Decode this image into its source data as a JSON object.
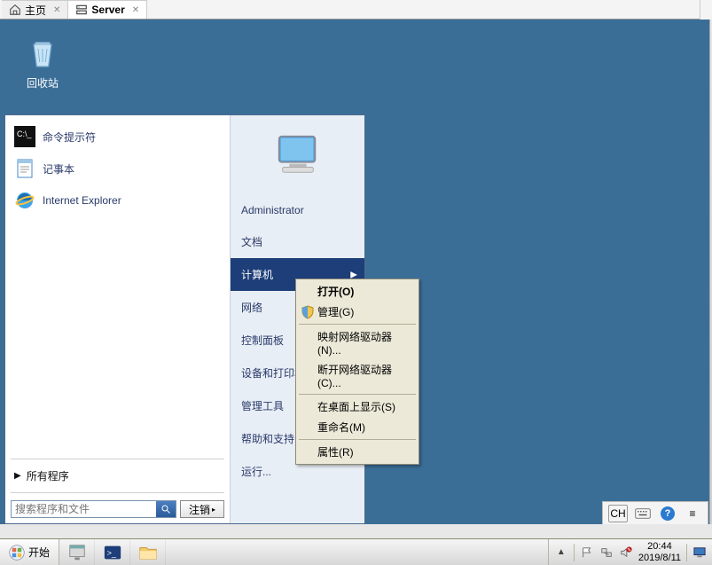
{
  "tabs": {
    "home": "主页",
    "server": "Server"
  },
  "desktop": {
    "recycle_bin": "回收站"
  },
  "start_menu": {
    "programs": {
      "cmd": "命令提示符",
      "notepad": "记事本",
      "ie": "Internet Explorer"
    },
    "all_programs": "所有程序",
    "search_placeholder": "搜索程序和文件",
    "logoff": "注销",
    "right": {
      "username": "Administrator",
      "documents": "文档",
      "computer": "计算机",
      "network": "网络",
      "control_panel": "控制面板",
      "devices_printers": "设备和打印机",
      "admin_tools": "管理工具",
      "help_support": "帮助和支持",
      "run": "运行..."
    }
  },
  "context_menu": {
    "open": "打开(O)",
    "manage": "管理(G)",
    "map_drive": "映射网络驱动器(N)...",
    "disconnect_drive": "断开网络驱动器(C)...",
    "show_on_desktop": "在桌面上显示(S)",
    "rename": "重命名(M)",
    "properties": "属性(R)"
  },
  "aux_bar": {
    "ch": "CH"
  },
  "tray": {
    "time": "20:44",
    "date": "2019/8/11"
  },
  "taskbar": {
    "start": "开始"
  },
  "icons": {
    "home": "home-icon",
    "server": "server-icon",
    "close": "close-icon",
    "recycle": "recycle-bin-icon",
    "cmd": "cmd-icon",
    "notepad": "notepad-icon",
    "ie": "ie-icon",
    "avatar": "monitor-avatar-icon",
    "shield": "shield-icon",
    "search": "search-icon",
    "start": "windows-logo-icon",
    "srvmgr": "server-manager-icon",
    "powershell": "powershell-icon",
    "explorer": "explorer-icon",
    "up": "chevron-up-icon",
    "net": "network-tray-icon",
    "vol": "volume-tray-icon",
    "mon": "monitor-tray-icon",
    "keyboard": "keyboard-icon",
    "help": "help-icon"
  }
}
